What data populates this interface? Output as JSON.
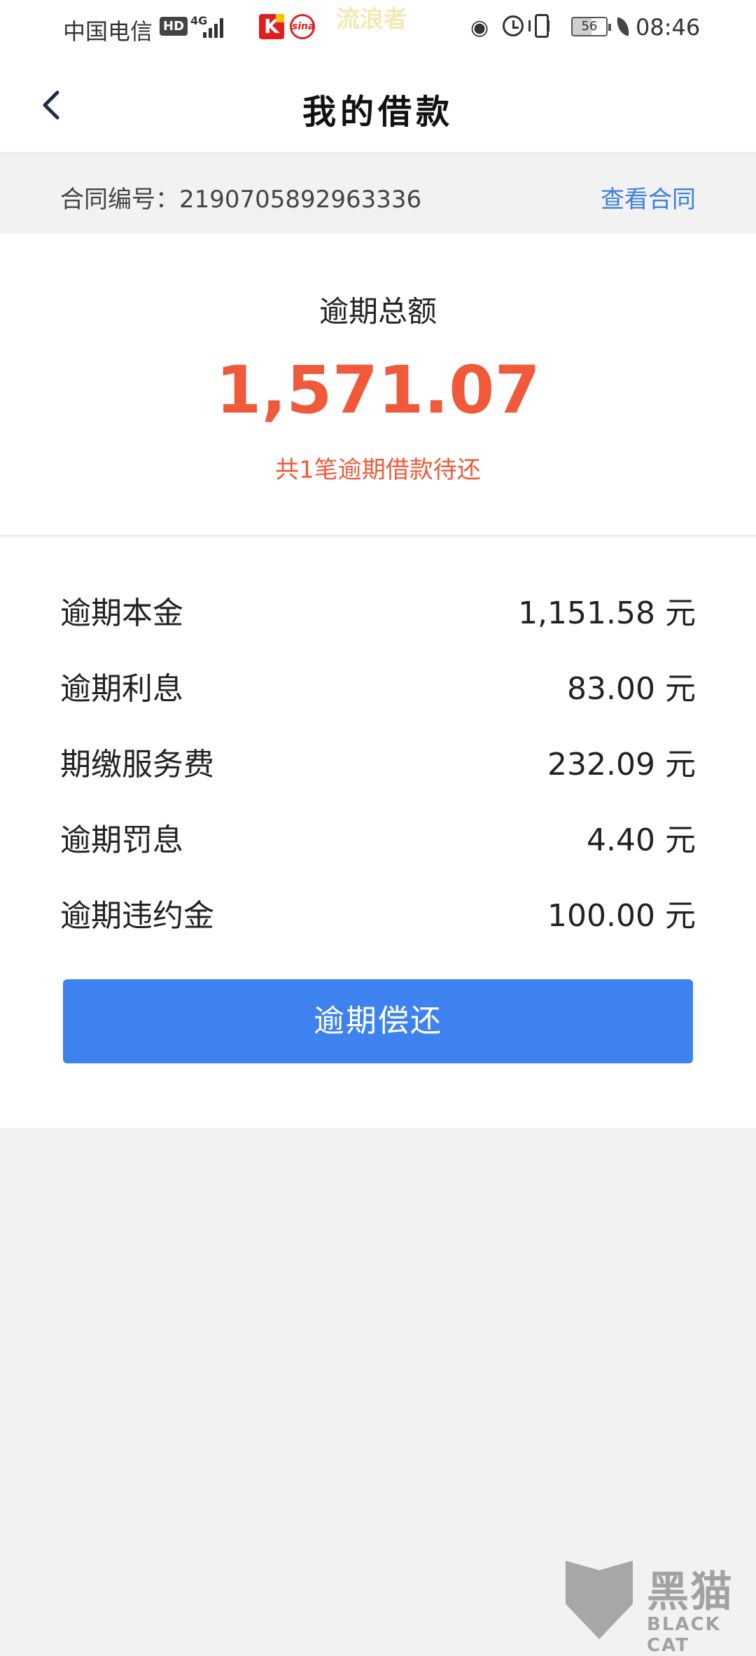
{
  "status_bar": {
    "carrier": "中国电信",
    "hd_badge": "HD",
    "network": "4G",
    "sina_logo": "sina",
    "watermark": "流浪者",
    "eye_icon": "eye-icon",
    "battery_level": "56",
    "time": "08:46"
  },
  "navbar": {
    "title": "我的借款",
    "back_icon": "chevron-left-icon"
  },
  "contract": {
    "label": "合同编号：2190705892963336",
    "link": "查看合同"
  },
  "summary": {
    "label": "逾期总额",
    "amount": "1,571.07",
    "note": "共1笔逾期借款待还"
  },
  "details": [
    {
      "label": "逾期本金",
      "value": "1,151.58 元"
    },
    {
      "label": "逾期利息",
      "value": "83.00 元"
    },
    {
      "label": "期缴服务费",
      "value": "232.09 元"
    },
    {
      "label": "逾期罚息",
      "value": "4.40 元"
    },
    {
      "label": "逾期违约金",
      "value": "100.00 元"
    }
  ],
  "repay_button": {
    "label": "逾期偿还"
  },
  "logo": {
    "name": "黑猫",
    "sub": "BLACK CAT"
  },
  "colors": {
    "accent_blue": "#3d82ef",
    "link_blue": "#3d7fe0",
    "overdue_red": "#f05a3a",
    "page_bg": "#f2f2f2"
  }
}
